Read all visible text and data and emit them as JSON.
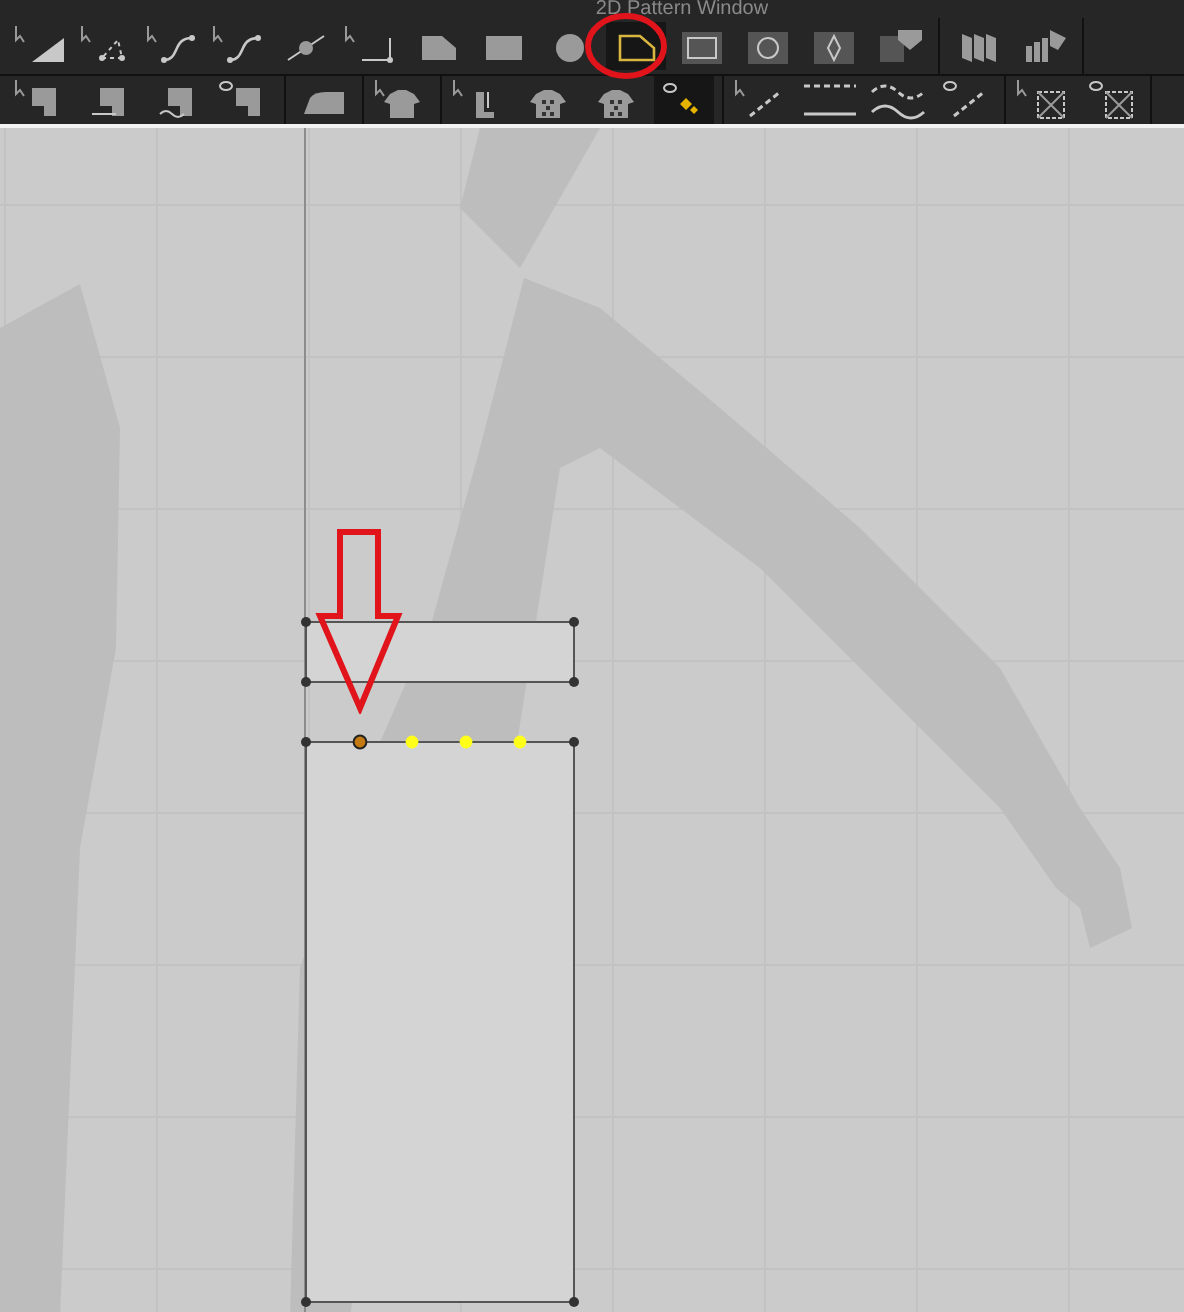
{
  "window": {
    "title": "2D Pattern Window"
  },
  "toolbars": [
    {
      "groups": [
        {
          "tools": [
            {
              "kind": "select",
              "selected": false
            },
            {
              "kind": "edit-point",
              "selected": false
            },
            {
              "kind": "curve",
              "selected": false
            },
            {
              "kind": "curve-point",
              "selected": false
            },
            {
              "kind": "add-point",
              "selected": false
            },
            {
              "kind": "corner",
              "selected": false
            },
            {
              "kind": "polygon",
              "selected": false
            },
            {
              "kind": "rectangle",
              "selected": false
            },
            {
              "kind": "circle",
              "selected": false
            },
            {
              "kind": "outline-polygon",
              "selected": true
            },
            {
              "kind": "outline-rectangle",
              "selected": false
            },
            {
              "kind": "outline-circle",
              "selected": false
            },
            {
              "kind": "diamond",
              "selected": false
            },
            {
              "kind": "shield",
              "selected": false
            }
          ]
        },
        {
          "tools": [
            {
              "kind": "panels",
              "selected": false
            },
            {
              "kind": "stack",
              "selected": false
            }
          ]
        }
      ]
    },
    {
      "groups": [
        {
          "tools": [
            {
              "kind": "sew",
              "selected": false
            },
            {
              "kind": "sew-line",
              "selected": false
            },
            {
              "kind": "sew-wave",
              "selected": false
            },
            {
              "kind": "sew-eye",
              "selected": false
            }
          ]
        },
        {
          "tools": [
            {
              "kind": "iron",
              "selected": false
            }
          ]
        },
        {
          "tools": [
            {
              "kind": "shirt",
              "selected": false
            }
          ]
        },
        {
          "tools": [
            {
              "kind": "hand",
              "selected": false
            },
            {
              "kind": "shirt-check",
              "selected": false
            },
            {
              "kind": "shirt-dots",
              "selected": false
            },
            {
              "kind": "eye-dots",
              "selected": true
            }
          ]
        },
        {
          "tools": [
            {
              "kind": "line",
              "selected": false
            },
            {
              "kind": "dash",
              "selected": false
            },
            {
              "kind": "wave",
              "selected": false
            },
            {
              "kind": "eye-line",
              "selected": false
            }
          ]
        },
        {
          "tools": [
            {
              "kind": "grid",
              "selected": false
            },
            {
              "kind": "eye-grid",
              "selected": false
            }
          ]
        }
      ]
    }
  ],
  "canvas": {
    "patterns": [
      {
        "kind": "plain"
      },
      {
        "kind": "plain",
        "points": [
          {
            "selected": true
          },
          {
            "selected": false
          },
          {
            "selected": false
          },
          {
            "selected": false
          }
        ]
      }
    ],
    "annotations": [
      {
        "kind": "circle"
      },
      {
        "kind": "arrow"
      }
    ]
  }
}
